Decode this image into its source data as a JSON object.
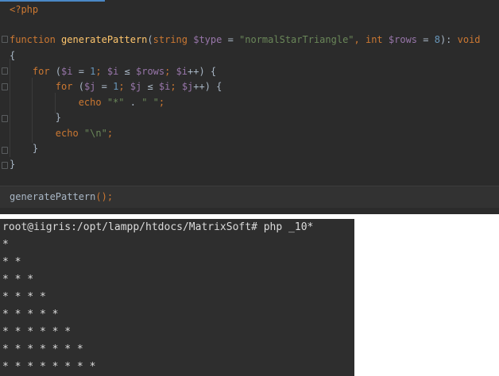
{
  "editor": {
    "lines": [
      [
        {
          "t": "<?php",
          "c": "tag"
        }
      ],
      [],
      [
        {
          "t": "function ",
          "c": "kw"
        },
        {
          "t": "generatePattern",
          "c": "fn"
        },
        {
          "t": "(",
          "c": "plain"
        },
        {
          "t": "string ",
          "c": "kw"
        },
        {
          "t": "$type",
          "c": "var"
        },
        {
          "t": " = ",
          "c": "plain"
        },
        {
          "t": "\"normalStarTriangle\"",
          "c": "str"
        },
        {
          "t": ", ",
          "c": "kw"
        },
        {
          "t": "int ",
          "c": "kw"
        },
        {
          "t": "$rows",
          "c": "var"
        },
        {
          "t": " = ",
          "c": "plain"
        },
        {
          "t": "8",
          "c": "num"
        },
        {
          "t": "): ",
          "c": "plain"
        },
        {
          "t": "void",
          "c": "kw"
        }
      ],
      [
        {
          "t": "{",
          "c": "plain"
        }
      ],
      [],
      [
        {
          "t": "    for ",
          "c": "kw"
        },
        {
          "t": "(",
          "c": "plain"
        },
        {
          "t": "$i",
          "c": "var"
        },
        {
          "t": " = ",
          "c": "plain"
        },
        {
          "t": "1",
          "c": "num"
        },
        {
          "t": "; ",
          "c": "kw"
        },
        {
          "t": "$i",
          "c": "var"
        },
        {
          "t": " ≤ ",
          "c": "plain"
        },
        {
          "t": "$rows",
          "c": "var"
        },
        {
          "t": "; ",
          "c": "kw"
        },
        {
          "t": "$i",
          "c": "var"
        },
        {
          "t": "++) {",
          "c": "plain"
        }
      ],
      [
        {
          "t": "        for ",
          "c": "kw"
        },
        {
          "t": "(",
          "c": "plain"
        },
        {
          "t": "$j",
          "c": "var"
        },
        {
          "t": " = ",
          "c": "plain"
        },
        {
          "t": "1",
          "c": "num"
        },
        {
          "t": "; ",
          "c": "kw"
        },
        {
          "t": "$j",
          "c": "var"
        },
        {
          "t": " ≤ ",
          "c": "plain"
        },
        {
          "t": "$i",
          "c": "var"
        },
        {
          "t": "; ",
          "c": "kw"
        },
        {
          "t": "$j",
          "c": "var"
        },
        {
          "t": "++) {",
          "c": "plain"
        }
      ],
      [
        {
          "t": "            echo ",
          "c": "kw"
        },
        {
          "t": "\"*\"",
          "c": "str"
        },
        {
          "t": " . ",
          "c": "plain"
        },
        {
          "t": "\" \"",
          "c": "str"
        },
        {
          "t": ";",
          "c": "kw"
        }
      ],
      [
        {
          "t": "        }",
          "c": "plain"
        }
      ],
      [
        {
          "t": "        echo ",
          "c": "kw"
        },
        {
          "t": "\"\\n\"",
          "c": "str"
        },
        {
          "t": ";",
          "c": "kw"
        }
      ],
      [
        {
          "t": "    }",
          "c": "plain"
        }
      ],
      [
        {
          "t": "}",
          "c": "plain"
        }
      ],
      [],
      [
        {
          "t": "generatePattern",
          "c": "plain"
        },
        {
          "t": "();",
          "c": "kw"
        }
      ]
    ]
  },
  "terminal": {
    "prompt": "root@iigris:/opt/lampp/htdocs/MatrixSoft#",
    "command": "php _10*",
    "output": [
      "*",
      "* *",
      "* * *",
      "* * * *",
      "* * * * *",
      "* * * * * *",
      "* * * * * * *",
      "* * * * * * * *"
    ]
  }
}
